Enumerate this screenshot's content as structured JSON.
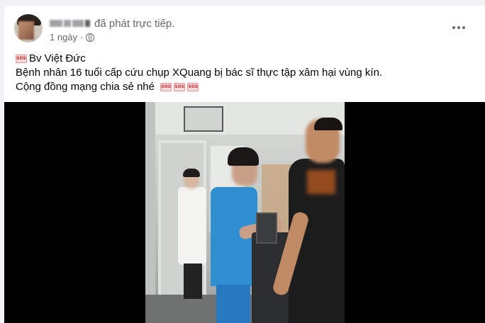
{
  "post": {
    "author_action": "đã phát trực tiếp.",
    "time": "1 ngày",
    "dot": "·",
    "lines": {
      "line1": "Bv Việt Đức",
      "line2": "Bệnh nhân 16 tuổi cấp cứu chụp XQuang bị bác sĩ thực tập xâm hại vùng kín.",
      "line3": "Cộng đồng mạng chia sẻ nhé"
    },
    "emoji": {
      "sos": "SOS"
    }
  },
  "colors": {
    "background": "#f0f2f5",
    "card": "#ffffff",
    "secondary_text": "#65676b",
    "scrub_blue": "#2f8fd0"
  },
  "icons": {
    "privacy": "globe-icon",
    "menu": "more-options-icon",
    "emoji": "sos-emoji-icon"
  }
}
